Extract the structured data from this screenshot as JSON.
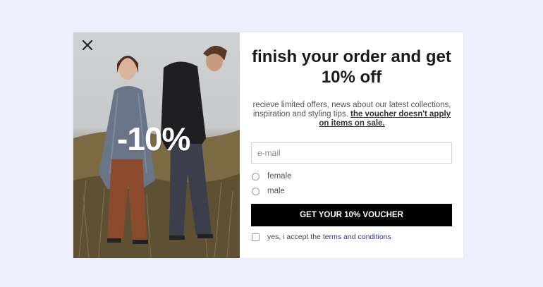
{
  "popup": {
    "discount_label": "-10%",
    "title": "finish your order and get 10% off",
    "description": "recieve limited offers, news about our latest collections, inspiration and styling tips.",
    "description_link": "the voucher doesn't apply on items on sale.",
    "email_placeholder": "e-mail",
    "gender_options": [
      "female",
      "male"
    ],
    "cta_label": "GET YOUR 10% VOUCHER",
    "consent_text": "yes, i accept the",
    "consent_link": "terms and conditions"
  },
  "icons": {
    "close": "close-icon"
  },
  "colors": {
    "background": "#eeeffc",
    "cta": "#000000",
    "link": "#2d3a92"
  }
}
